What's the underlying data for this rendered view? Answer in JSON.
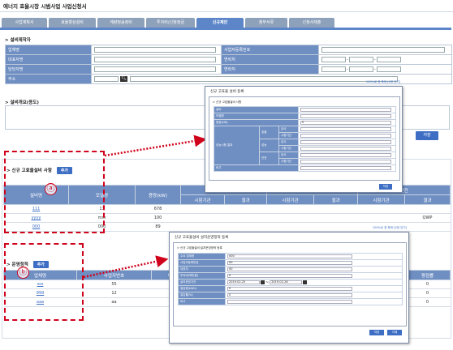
{
  "page": {
    "title": "에너지 효율시장 시범사업 사업신청서"
  },
  "tabs": [
    {
      "label": "사업계획서",
      "active": false
    },
    {
      "label": "효율향상설비",
      "active": false
    },
    {
      "label": "계량정송정비",
      "active": false
    },
    {
      "label": "투자비/신청정금",
      "active": false
    },
    {
      "label": "신규제안",
      "active": true
    },
    {
      "label": "첨부서류",
      "active": false
    },
    {
      "label": "신청서제출",
      "active": false
    }
  ],
  "installer": {
    "heading": "> 설비제작자",
    "fields": {
      "company_name": "업체명",
      "business_number": "사업자등록번호",
      "representative": "대표자명",
      "contact": "연락처",
      "manager": "담당자명",
      "manager_contact": "연락처",
      "address": "주소"
    }
  },
  "overview": {
    "heading": "> 설비개요(용도)",
    "save_label": "저장"
  },
  "new_equipment": {
    "heading": "> 신규 고효율설비 사항",
    "add_label": "추가",
    "headers": {
      "name": "설비명",
      "model": "모델명",
      "capacity": "용량(kW)",
      "efficiency": "효율",
      "performance": "성능",
      "safety": "안전",
      "test_org": "시험기관",
      "result": "결과"
    },
    "rows": [
      {
        "name": "111",
        "model": "11",
        "capacity": "678",
        "safety_result": ""
      },
      {
        "name": "yyyy",
        "model": "mm",
        "capacity": "100",
        "safety_result": "QWP"
      },
      {
        "name": "000",
        "model": "000",
        "capacity": "89",
        "safety_result": ""
      }
    ]
  },
  "operation": {
    "heading": "> 운영정적",
    "add_label": "추가",
    "headers": {
      "company": "업체명",
      "business_number": "사업자번호",
      "representative": "대표자",
      "satisfaction": "평점률"
    },
    "rows": [
      {
        "company": "sss",
        "business_number": "55",
        "representative": "",
        "satisfaction": "0"
      },
      {
        "company": "999",
        "business_number": "12",
        "representative": "888",
        "satisfaction": "0"
      },
      {
        "company": "aaa",
        "business_number": "aa",
        "representative": "",
        "satisfaction": "0"
      }
    ]
  },
  "markers": {
    "a": "ⓐ",
    "b": "ⓑ"
  },
  "popup_a": {
    "title": "신규 고효율 설비 등록",
    "close_label": "100%로 창 확대 [X창 닫기]",
    "subheading": "> 신규 고효율설비 사항",
    "rows": {
      "name": "설비",
      "model": "모델명",
      "capacity": "용량(kW)",
      "test_org_label": "성능시험 결과",
      "efficiency": "효율",
      "performance": "성능",
      "safety": "안전",
      "org": "검사",
      "result": "시험기관",
      "note": "비고"
    },
    "capacity_value": "0",
    "save_label": "저장"
  },
  "popup_b": {
    "title": "신규 고효율설비 설치운영정적 등록",
    "close_label": "100%로 창 확대 [X창 닫기]",
    "subheading": "> 신규 고효율설비 설치운영정적 등록",
    "fields": [
      {
        "label": "수요 업체명",
        "value": "000"
      },
      {
        "label": "사업자등록번호",
        "value": "00"
      },
      {
        "label": "대표자",
        "value": "00"
      },
      {
        "label": "투자비(백만원)",
        "value": "0"
      },
      {
        "label": "설치운영기간",
        "value": ""
      },
      {
        "label": "절감량(kWh)",
        "value": "0"
      },
      {
        "label": "절감률(%)",
        "value": "0"
      },
      {
        "label": "비고",
        "value": ""
      }
    ],
    "date_from": "2019-02-25",
    "date_to": "2019-02-28",
    "save_label": "저장",
    "delete_label": "삭제"
  },
  "colors": {
    "accent": "#3d6ec4",
    "header_blue": "#6f8fc3",
    "annotation_red": "#d0021b"
  }
}
